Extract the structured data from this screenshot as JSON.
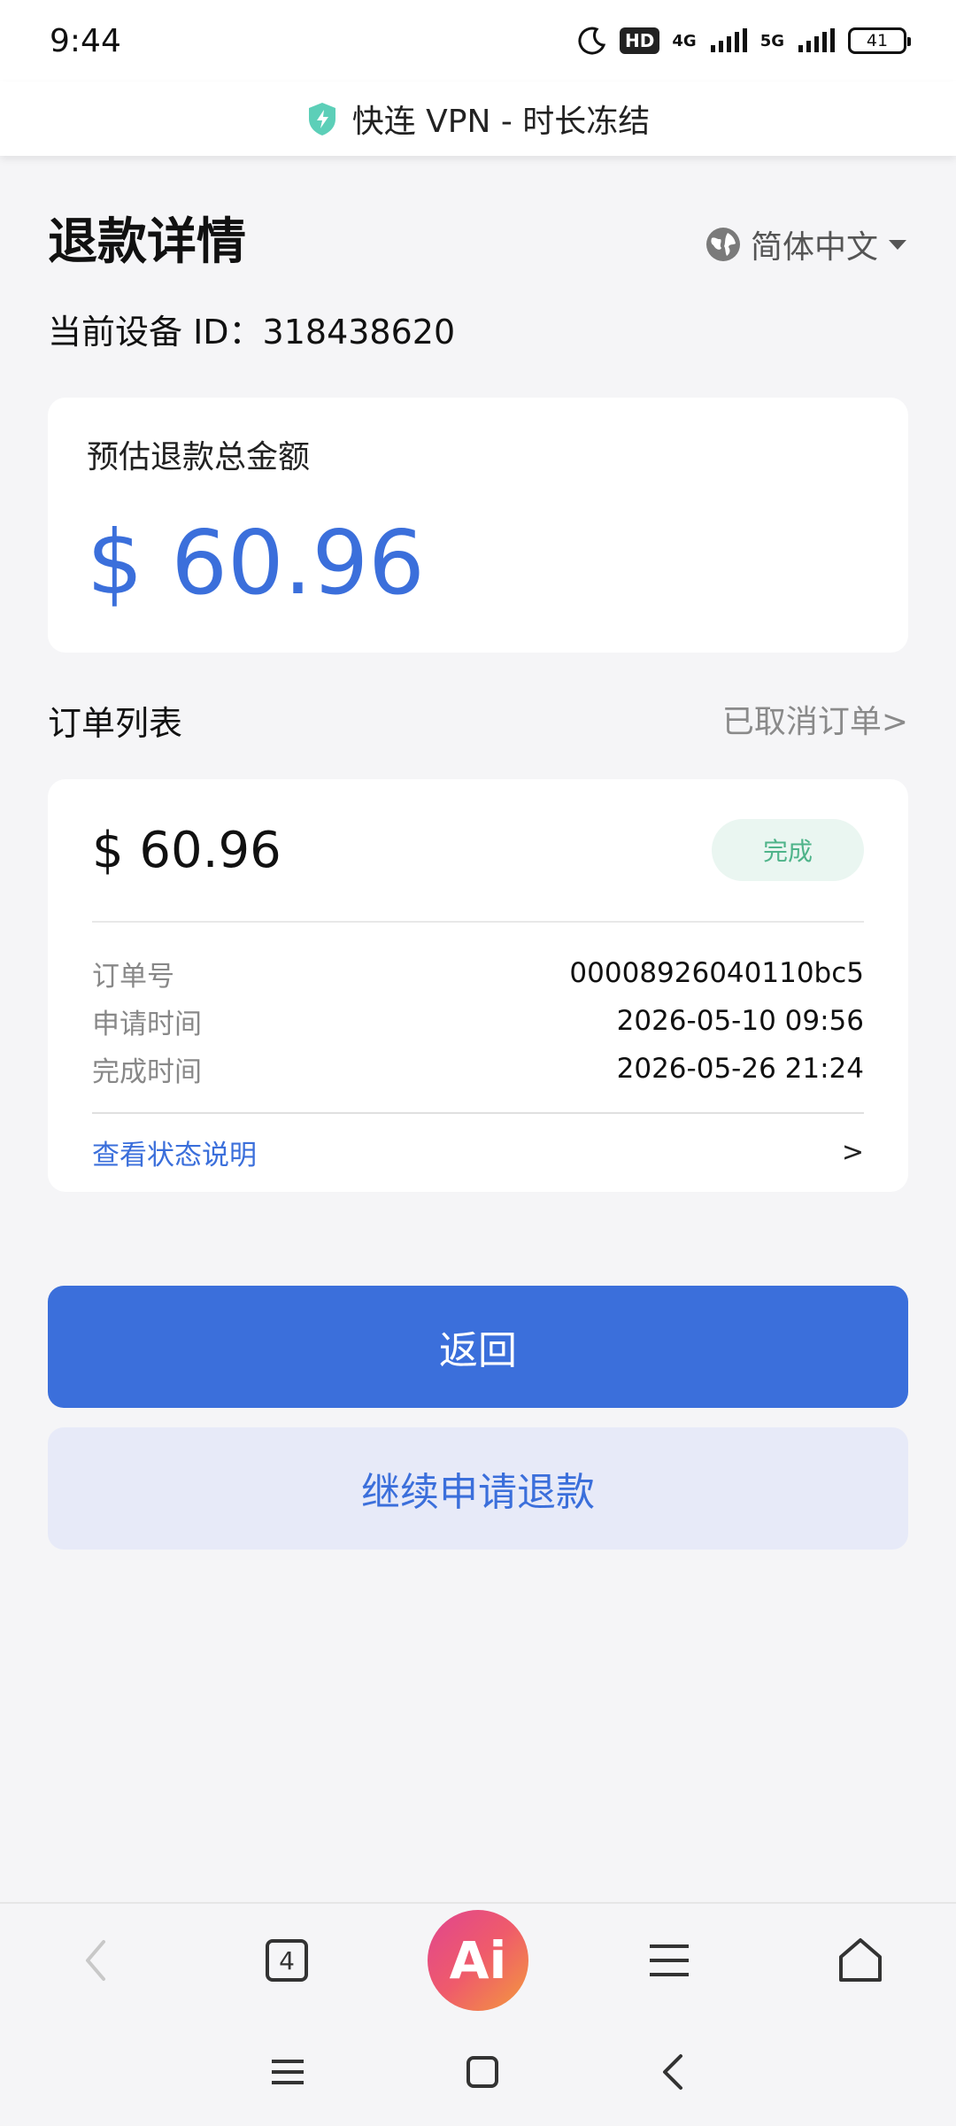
{
  "status_bar": {
    "time": "9:44",
    "hd_label": "HD",
    "net1": "4G",
    "net2": "5G",
    "battery": "41"
  },
  "title_bar": {
    "title": "快连 VPN - 时长冻结",
    "shield_color": "#5ccfb8"
  },
  "header": {
    "heading": "退款详情",
    "language": "简体中文",
    "device_id": "当前设备 ID：318438620"
  },
  "total_card": {
    "label": "预估退款总金额",
    "amount": "$ 60.96"
  },
  "order_list": {
    "title": "订单列表",
    "cancelled_link": "已取消订单>"
  },
  "order": {
    "amount": "$ 60.96",
    "status": "完成",
    "rows": [
      {
        "key": "订单号",
        "value": "00008926040110bc5"
      },
      {
        "key": "申请时间",
        "value": "2026-05-10 09:56"
      },
      {
        "key": "完成时间",
        "value": "2026-05-26 21:24"
      }
    ],
    "status_link": "查看状态说明",
    "status_arrow": ">"
  },
  "buttons": {
    "back": "返回",
    "continue": "继续申请退款"
  },
  "browser_bar": {
    "tab_count": "4",
    "ai_label": "Ai"
  },
  "colors": {
    "accent": "#3b6fdb",
    "success": "#4fb48a"
  }
}
